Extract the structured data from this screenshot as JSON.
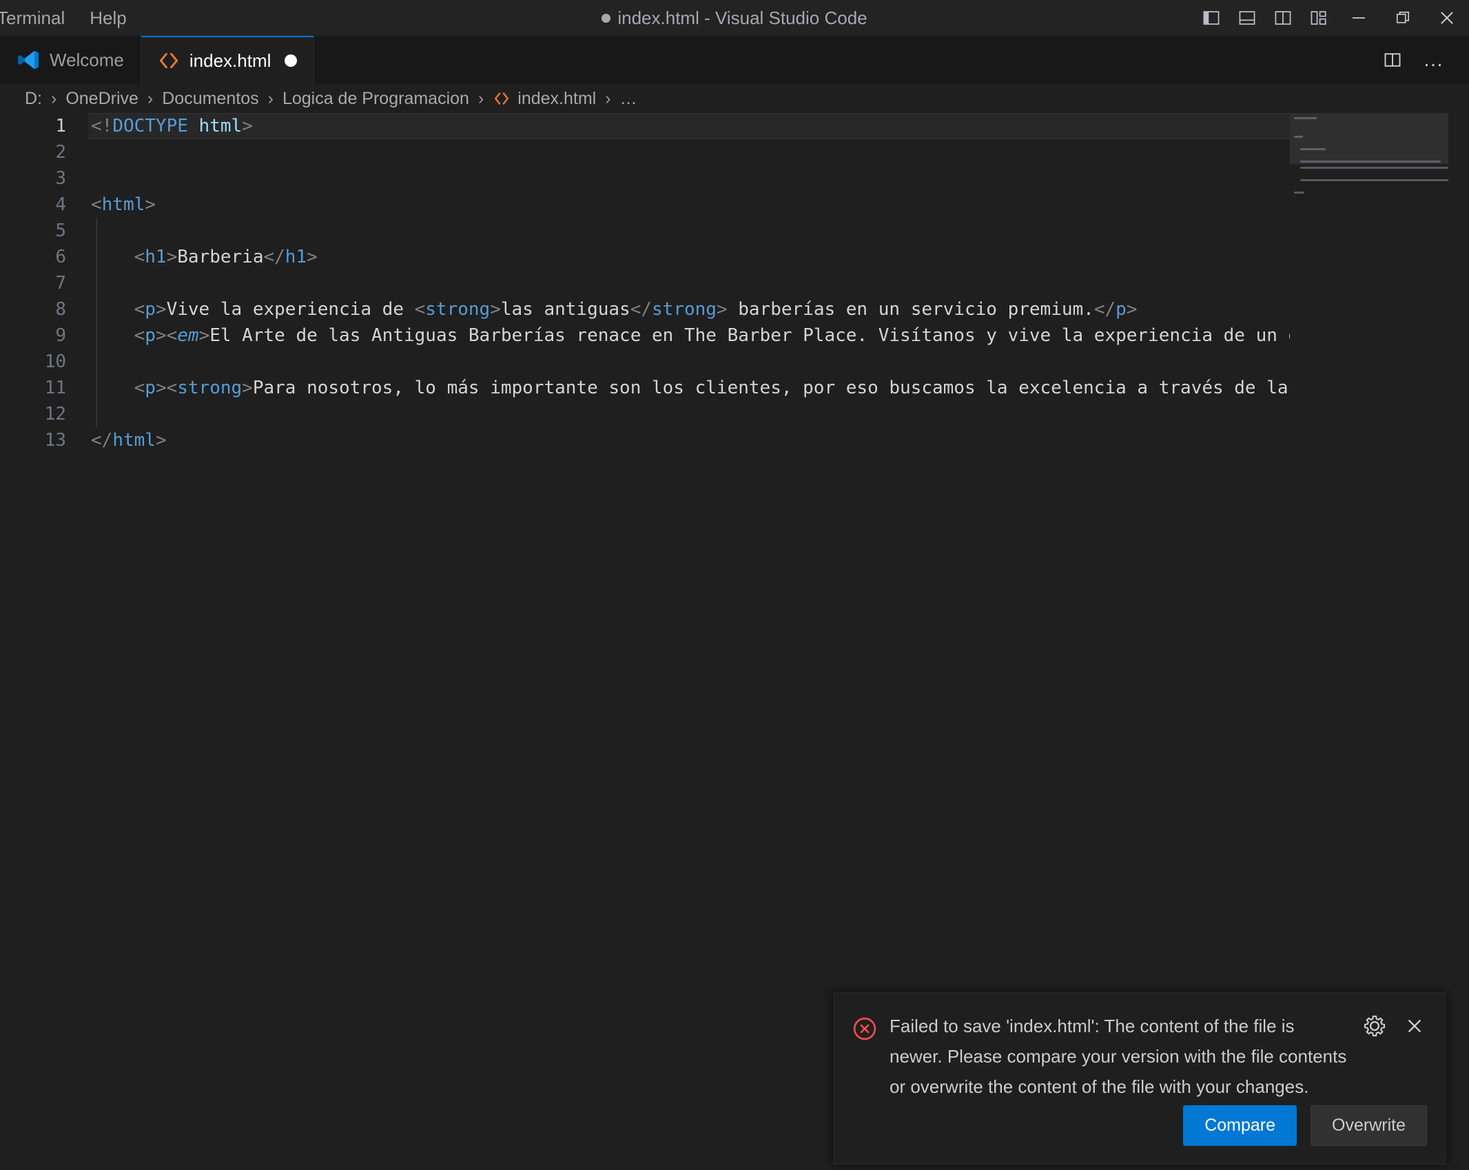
{
  "window": {
    "title": "index.html - Visual Studio Code",
    "dirty": true,
    "menus": [
      "Terminal",
      "Help"
    ],
    "layout_buttons": [
      {
        "name": "toggle-primary-sidebar",
        "label": "Toggle Primary Side Bar"
      },
      {
        "name": "toggle-panel",
        "label": "Toggle Panel"
      },
      {
        "name": "toggle-secondary-sidebar",
        "label": "Toggle Secondary Side Bar"
      },
      {
        "name": "customize-layout",
        "label": "Customize Layout"
      }
    ],
    "controls": [
      {
        "name": "minimize",
        "label": "Minimize"
      },
      {
        "name": "restore",
        "label": "Restore"
      },
      {
        "name": "close",
        "label": "Close"
      }
    ]
  },
  "tabs": [
    {
      "label": "Welcome",
      "icon": "vscode-logo-icon",
      "active": false,
      "dirty": false
    },
    {
      "label": "index.html",
      "icon": "html-file-icon",
      "active": true,
      "dirty": true
    }
  ],
  "tabbar_actions": [
    {
      "name": "split-editor-right",
      "label": "Split Editor Right"
    },
    {
      "name": "more-actions",
      "label": "More Actions...",
      "glyph": "…"
    }
  ],
  "breadcrumb": {
    "separator": "›",
    "items": [
      {
        "label": "D:",
        "icon": null
      },
      {
        "label": "OneDrive",
        "icon": null
      },
      {
        "label": "Documentos",
        "icon": null
      },
      {
        "label": "Logica de Programacion",
        "icon": null
      },
      {
        "label": "index.html",
        "icon": "html-file-icon"
      },
      {
        "label": "…",
        "icon": null
      }
    ]
  },
  "editor": {
    "language": "html",
    "current_line": 1,
    "lines": [
      {
        "n": "1",
        "current": true,
        "indent_guide": false,
        "tokens": [
          {
            "t": "<!",
            "c": "br"
          },
          {
            "t": "DOCTYPE",
            "c": "dt"
          },
          {
            "t": " ",
            "c": "txt"
          },
          {
            "t": "html",
            "c": "dtv"
          },
          {
            "t": ">",
            "c": "br"
          }
        ]
      },
      {
        "n": "2",
        "current": false,
        "indent_guide": false,
        "tokens": []
      },
      {
        "n": "3",
        "current": false,
        "indent_guide": false,
        "tokens": []
      },
      {
        "n": "4",
        "current": false,
        "indent_guide": false,
        "tokens": [
          {
            "t": "<",
            "c": "br"
          },
          {
            "t": "html",
            "c": "tg"
          },
          {
            "t": ">",
            "c": "br"
          }
        ]
      },
      {
        "n": "5",
        "current": false,
        "indent_guide": true,
        "tokens": []
      },
      {
        "n": "6",
        "current": false,
        "indent_guide": true,
        "tokens": [
          {
            "t": "    ",
            "c": "txt"
          },
          {
            "t": "<",
            "c": "br"
          },
          {
            "t": "h1",
            "c": "tg"
          },
          {
            "t": ">",
            "c": "br"
          },
          {
            "t": "Barberia",
            "c": "txt"
          },
          {
            "t": "</",
            "c": "br"
          },
          {
            "t": "h1",
            "c": "tg"
          },
          {
            "t": ">",
            "c": "br"
          }
        ]
      },
      {
        "n": "7",
        "current": false,
        "indent_guide": true,
        "tokens": []
      },
      {
        "n": "8",
        "current": false,
        "indent_guide": true,
        "tokens": [
          {
            "t": "    ",
            "c": "txt"
          },
          {
            "t": "<",
            "c": "br"
          },
          {
            "t": "p",
            "c": "tg"
          },
          {
            "t": ">",
            "c": "br"
          },
          {
            "t": "Vive la experiencia de ",
            "c": "txt"
          },
          {
            "t": "<",
            "c": "br"
          },
          {
            "t": "strong",
            "c": "tg"
          },
          {
            "t": ">",
            "c": "br"
          },
          {
            "t": "las antiguas",
            "c": "txt"
          },
          {
            "t": "</",
            "c": "br"
          },
          {
            "t": "strong",
            "c": "tg"
          },
          {
            "t": ">",
            "c": "br"
          },
          {
            "t": " barberías en un servicio premium.",
            "c": "txt"
          },
          {
            "t": "</",
            "c": "br"
          },
          {
            "t": "p",
            "c": "tg"
          },
          {
            "t": ">",
            "c": "br"
          }
        ]
      },
      {
        "n": "9",
        "current": false,
        "indent_guide": true,
        "tokens": [
          {
            "t": "    ",
            "c": "txt"
          },
          {
            "t": "<",
            "c": "br"
          },
          {
            "t": "p",
            "c": "tg"
          },
          {
            "t": ">",
            "c": "br"
          },
          {
            "t": "<",
            "c": "br"
          },
          {
            "t": "em",
            "c": "tg em"
          },
          {
            "t": ">",
            "c": "br"
          },
          {
            "t": "El Arte de las Antiguas Barberías renace en The Barber Place. Visítanos y vive la experiencia de un e",
            "c": "txt"
          }
        ]
      },
      {
        "n": "10",
        "current": false,
        "indent_guide": true,
        "tokens": []
      },
      {
        "n": "11",
        "current": false,
        "indent_guide": true,
        "tokens": [
          {
            "t": "    ",
            "c": "txt"
          },
          {
            "t": "<",
            "c": "br"
          },
          {
            "t": "p",
            "c": "tg"
          },
          {
            "t": ">",
            "c": "br"
          },
          {
            "t": "<",
            "c": "br"
          },
          {
            "t": "strong",
            "c": "tg"
          },
          {
            "t": ">",
            "c": "br"
          },
          {
            "t": "Para nosotros, lo más importante son los clientes, por eso buscamos la excelencia a través de la",
            "c": "txt"
          }
        ]
      },
      {
        "n": "12",
        "current": false,
        "indent_guide": true,
        "tokens": []
      },
      {
        "n": "13",
        "current": false,
        "indent_guide": false,
        "tokens": [
          {
            "t": "</",
            "c": "br"
          },
          {
            "t": "html",
            "c": "tg"
          },
          {
            "t": ">",
            "c": "br"
          }
        ]
      }
    ]
  },
  "notification": {
    "severity": "error",
    "icon": "error-circle-x-icon",
    "message": "Failed to save 'index.html': The content of the file is newer. Please compare your version with the file contents or overwrite the content of the file with your changes.",
    "actions": [
      {
        "name": "notification-settings",
        "icon": "gear-icon"
      },
      {
        "name": "notification-close",
        "icon": "close-icon"
      }
    ],
    "buttons": [
      {
        "label": "Compare",
        "kind": "primary"
      },
      {
        "label": "Overwrite",
        "kind": "secondary"
      }
    ]
  },
  "colors": {
    "accent": "#0078d4",
    "tab_active_bg": "#1f1f1f",
    "editor_bg": "#1f1f1f",
    "titlebar_bg": "#232323",
    "tag": "#569cd6",
    "bracket": "#808080",
    "text": "#d4d4d4",
    "error": "#f14c4c",
    "html_icon": "#e37933"
  }
}
